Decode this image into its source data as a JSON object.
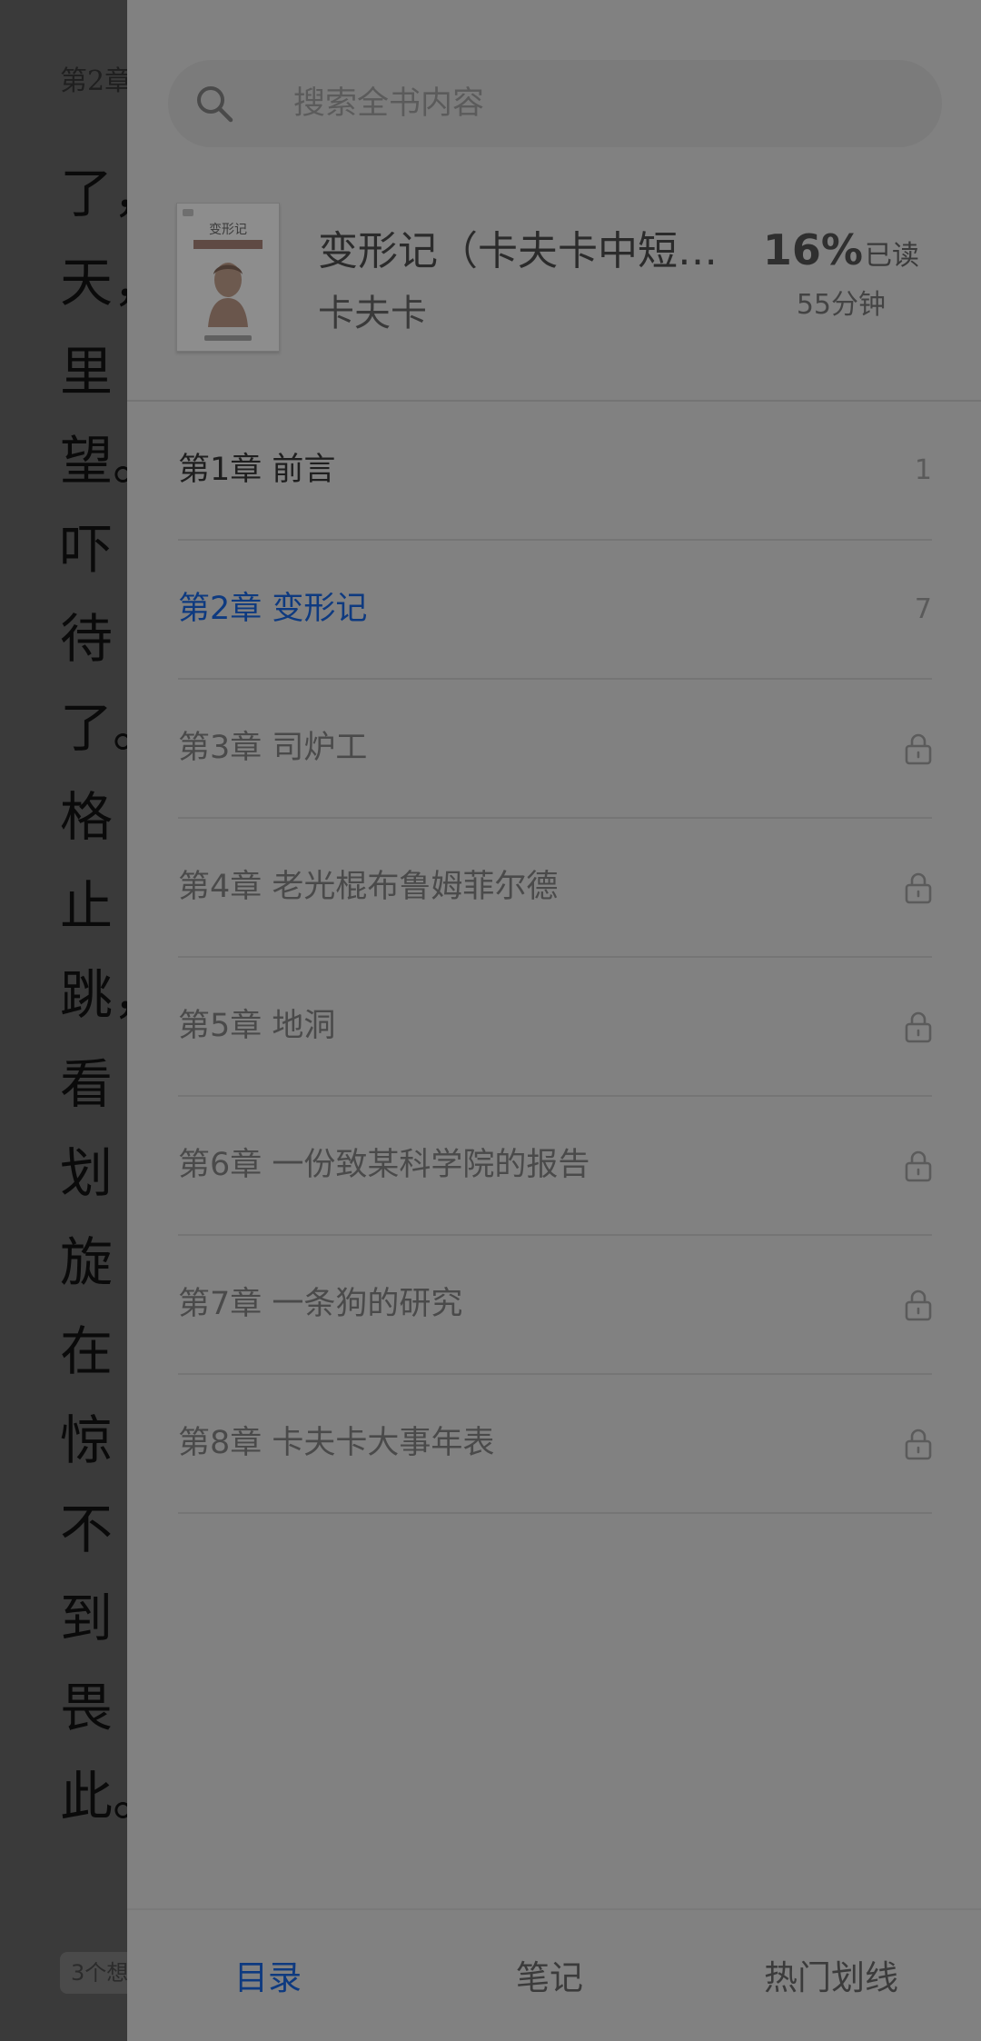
{
  "reader": {
    "chapter_header": "第2章",
    "lines": [
      "了，",
      "天，",
      "里",
      "望。",
      "吓",
      "待",
      "了。",
      "格",
      "止",
      "跳，",
      "看",
      "划",
      "旋",
      "在",
      "惊",
      "不",
      "到",
      "畏",
      "此。"
    ],
    "thoughts_badge": "3个想"
  },
  "search": {
    "placeholder": "搜索全书内容",
    "icon": "search-icon"
  },
  "book": {
    "cover_title": "变形记",
    "title": "变形记（卡夫卡中短…",
    "author": "卡夫卡",
    "progress_percent": "16%",
    "progress_label": "已读",
    "reading_time": "55分钟"
  },
  "toc": [
    {
      "label": "第1章 前言",
      "page": "1",
      "locked": false,
      "state": "done"
    },
    {
      "label": "第2章 变形记",
      "page": "7",
      "locked": false,
      "state": "current"
    },
    {
      "label": "第3章 司炉工",
      "page": "",
      "locked": true,
      "state": "locked"
    },
    {
      "label": "第4章 老光棍布鲁姆菲尔德",
      "page": "",
      "locked": true,
      "state": "locked"
    },
    {
      "label": "第5章 地洞",
      "page": "",
      "locked": true,
      "state": "locked"
    },
    {
      "label": "第6章 一份致某科学院的报告",
      "page": "",
      "locked": true,
      "state": "locked"
    },
    {
      "label": "第7章 一条狗的研究",
      "page": "",
      "locked": true,
      "state": "locked"
    },
    {
      "label": "第8章 卡夫卡大事年表",
      "page": "",
      "locked": true,
      "state": "locked"
    }
  ],
  "tabs": [
    {
      "label": "目录",
      "active": true
    },
    {
      "label": "笔记",
      "active": false
    },
    {
      "label": "热门划线",
      "active": false
    }
  ],
  "colors": {
    "accent": "#0e3a80",
    "drawer_bg": "#818181",
    "overlay_bg": "#3a3a3a"
  }
}
